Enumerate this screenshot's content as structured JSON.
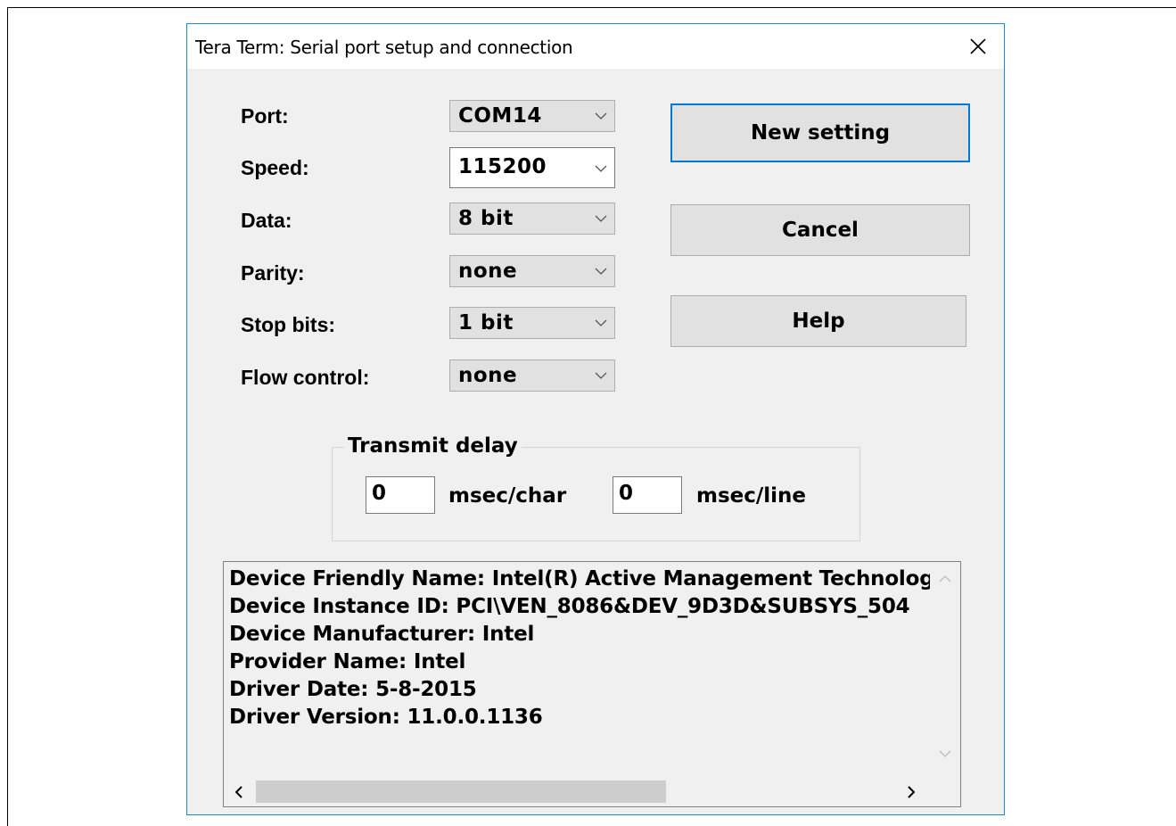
{
  "window": {
    "title": "Tera Term: Serial port setup and connection",
    "close_icon": "close-icon"
  },
  "fields": [
    {
      "label": "Port:",
      "value": "COM14"
    },
    {
      "label": "Speed:",
      "value": "115200"
    },
    {
      "label": "Data:",
      "value": "8 bit"
    },
    {
      "label": "Parity:",
      "value": "none"
    },
    {
      "label": "Stop bits:",
      "value": "1 bit"
    },
    {
      "label": "Flow control:",
      "value": "none"
    }
  ],
  "buttons": {
    "new_setting": "New setting",
    "cancel": "Cancel",
    "help": "Help"
  },
  "transmit_delay": {
    "title": "Transmit delay",
    "char_value": "0",
    "char_unit": "msec/char",
    "line_value": "0",
    "line_unit": "msec/line"
  },
  "device_info": [
    "Device Friendly Name: Intel(R) Active Management Technolog",
    "Device Instance ID: PCI\\VEN_8086&DEV_9D3D&SUBSYS_504",
    "Device Manufacturer: Intel",
    "Provider Name: Intel",
    "Driver Date: 5-8-2015",
    "Driver Version: 11.0.0.1136"
  ]
}
